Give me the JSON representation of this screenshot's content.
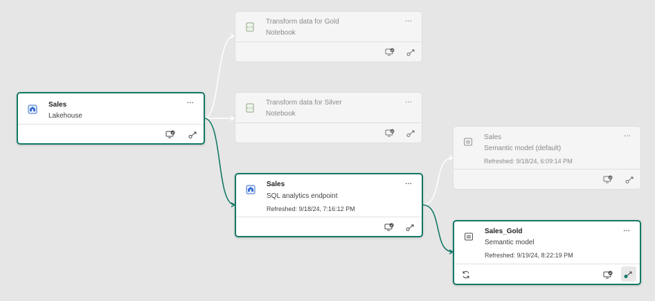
{
  "colors": {
    "background": "#e6e6e6",
    "active_border": "#117865",
    "active_link": "#117865",
    "inactive_link": "#ffffff"
  },
  "nodes": {
    "sales_lakehouse": {
      "name": "Sales",
      "type": "Lakehouse",
      "more": "...",
      "icon": "lakehouse-icon"
    },
    "transform_gold": {
      "name": "Transform data for Gold",
      "type": "Notebook",
      "more": "...",
      "icon": "notebook-icon"
    },
    "transform_silver": {
      "name": "Transform data for Silver",
      "type": "Notebook",
      "more": "...",
      "icon": "notebook-icon"
    },
    "sql_endpoint": {
      "name": "Sales",
      "type": "SQL analytics endpoint",
      "refreshed": "Refreshed: 9/18/24, 7:16:12 PM",
      "more": "...",
      "icon": "lakehouse-icon"
    },
    "semantic_default": {
      "name": "Sales",
      "type": "Semantic model (default)",
      "refreshed": "Refreshed: 9/18/24, 6:09:14 PM",
      "more": "...",
      "icon": "semantic-model-icon"
    },
    "sales_gold": {
      "name": "Sales_Gold",
      "type": "Semantic model",
      "refreshed": "Refreshed: 9/19/24, 8:22:19 PM",
      "more": "...",
      "icon": "semantic-model-icon"
    }
  }
}
